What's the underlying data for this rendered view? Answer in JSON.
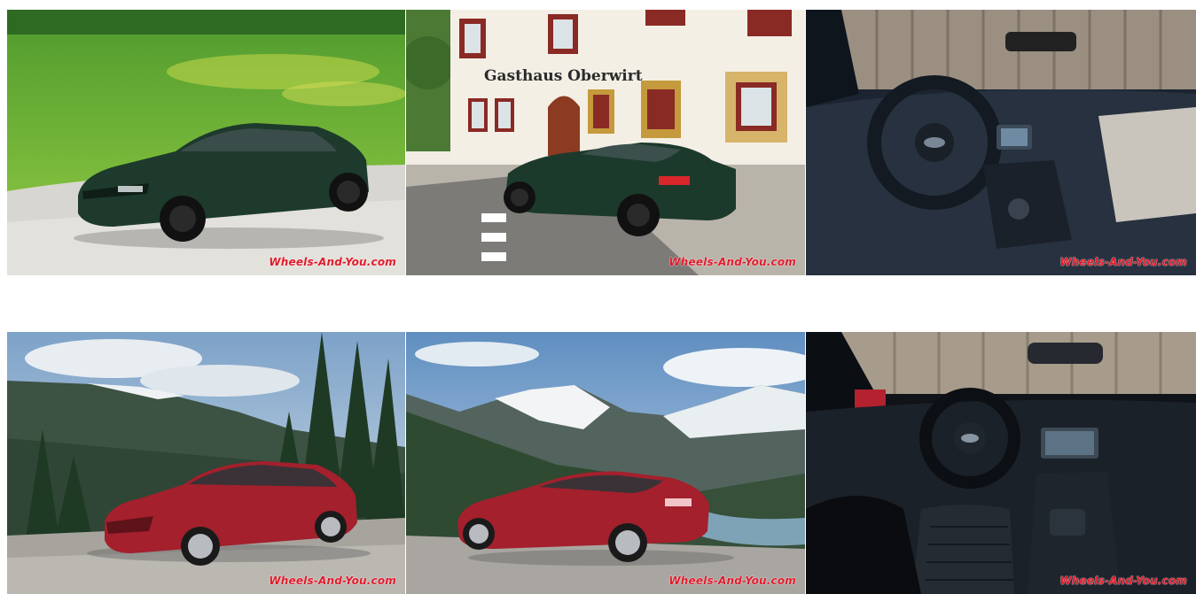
{
  "gallery": {
    "photos": [
      {
        "alt": "Dark green Jaguar XE parked on gravel beside a green meadow",
        "watermark": "Wheels-And-You.com"
      },
      {
        "alt": "Dark green Jaguar XE in front of Gasthaus Oberwirt",
        "sign": "Gasthaus Oberwirt",
        "watermark": "Wheels-And-You.com"
      },
      {
        "alt": "Jaguar XE interior with steering wheel and dashboard",
        "watermark": "Wheels-And-You.com"
      },
      {
        "alt": "Red Jaguar XF parked with mountains and pine trees",
        "watermark": "Wheels-And-You.com"
      },
      {
        "alt": "Red Jaguar XF rear view with snowy mountain valley",
        "watermark": "Wheels-And-You.com"
      },
      {
        "alt": "Jaguar XF interior with steering wheel and center console",
        "watermark": "Wheels-And-You.com"
      }
    ]
  }
}
